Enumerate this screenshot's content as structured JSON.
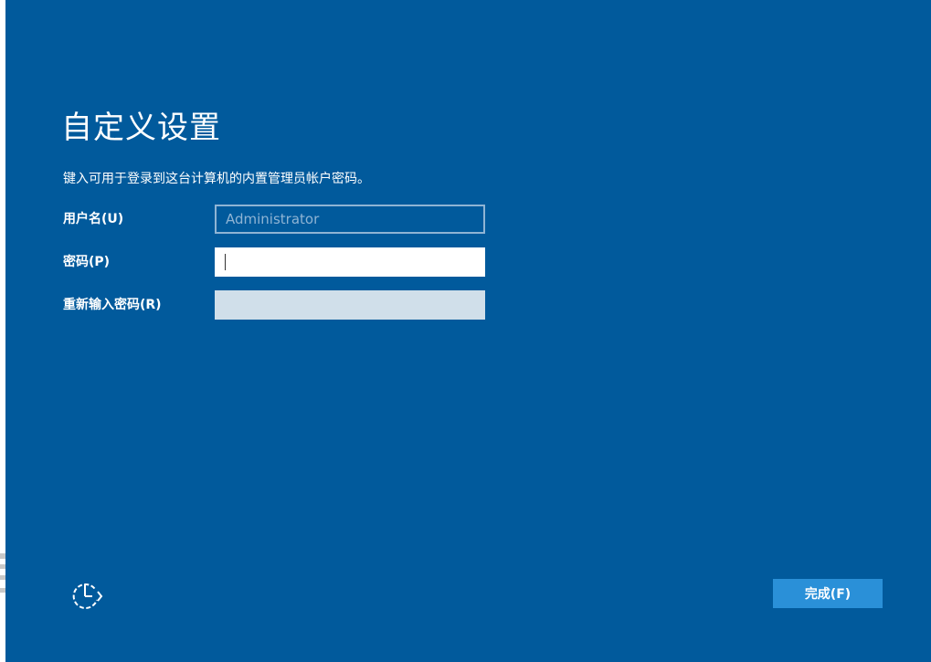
{
  "page": {
    "title": "自定义设置",
    "instructions": "键入可用于登录到这台计算机的内置管理员帐户密码。"
  },
  "form": {
    "username": {
      "label": "用户名(U)",
      "value": "Administrator",
      "placeholder": "Administrator"
    },
    "password": {
      "label": "密码(P)",
      "value": ""
    },
    "reenter_password": {
      "label": "重新输入密码(R)",
      "value": ""
    }
  },
  "footer": {
    "accessibility_icon": "ease-of-access-icon",
    "finish_label": "完成(F)"
  },
  "colors": {
    "background": "#015a9c",
    "text": "#ffffff",
    "button": "#2a90d8",
    "disabled_field": "#d0dfea",
    "readonly_border": "#8fb4d4"
  }
}
